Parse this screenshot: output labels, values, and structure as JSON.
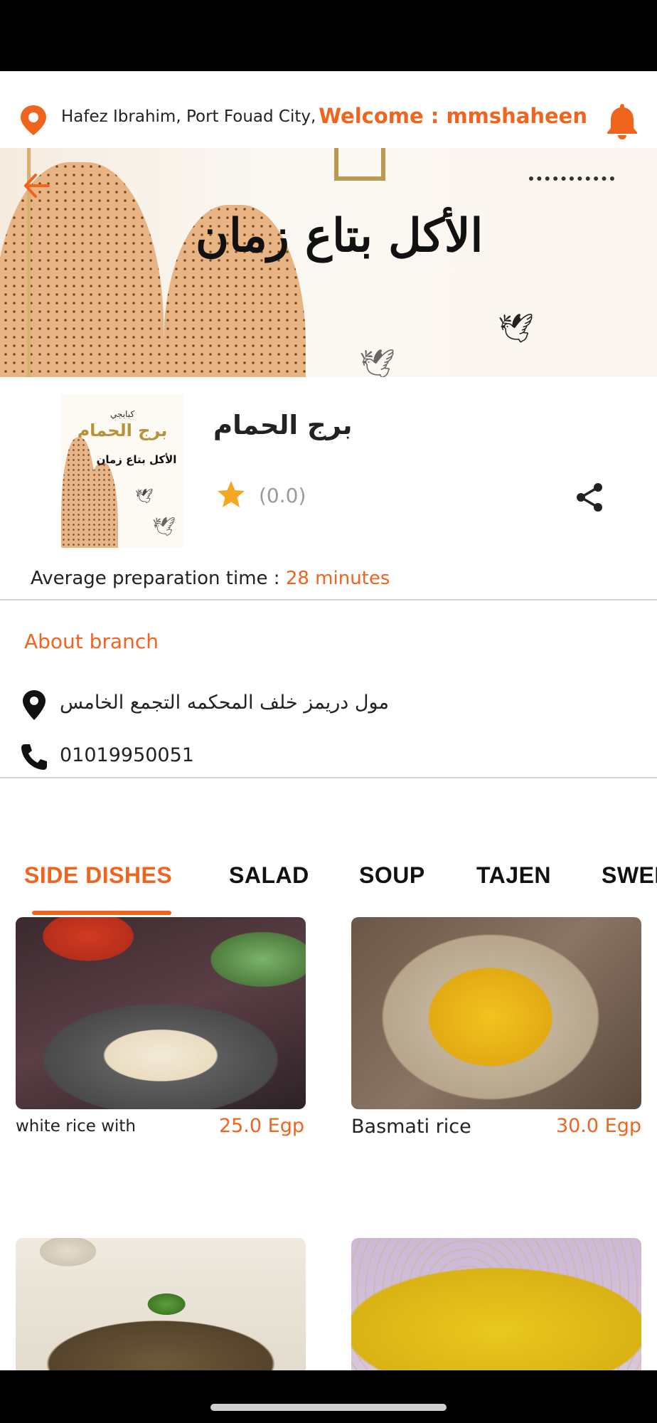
{
  "header": {
    "location": "Hafez Ibrahim, Port Fouad City,",
    "welcome": "Welcome : mmshaheen",
    "icons": [
      "location-pin-icon",
      "bell-icon"
    ]
  },
  "banner": {
    "slogan": "الأكل بتاع زمان",
    "back_icon": "arrow-left-icon"
  },
  "restaurant": {
    "name": "برج الحمام",
    "logo_title": "برج الحمام",
    "logo_subtitle": "الأكل بتاع زمان",
    "logo_top": "كبابجي",
    "rating": "(0.0)",
    "prep_label": "Average preparation time : ",
    "prep_value": "28 minutes"
  },
  "about": {
    "title": "About branch",
    "address": "مول دريمز خلف المحكمه التجمع الخامس",
    "phone": "01019950051"
  },
  "tabs": [
    "SIDE DISHES",
    "SALAD",
    "SOUP",
    "TAJEN",
    "SWEETS"
  ],
  "active_tab": "SIDE DISHES",
  "dishes": [
    {
      "name": "white rice with",
      "price": "25.0 Egp"
    },
    {
      "name": "Basmati rice",
      "price": "30.0 Egp"
    },
    {
      "name": "",
      "price": ""
    },
    {
      "name": "",
      "price": ""
    }
  ],
  "colors": {
    "accent": "#f0641e",
    "text": "#222222",
    "muted": "#9a9a9a",
    "star": "#f5a623"
  }
}
